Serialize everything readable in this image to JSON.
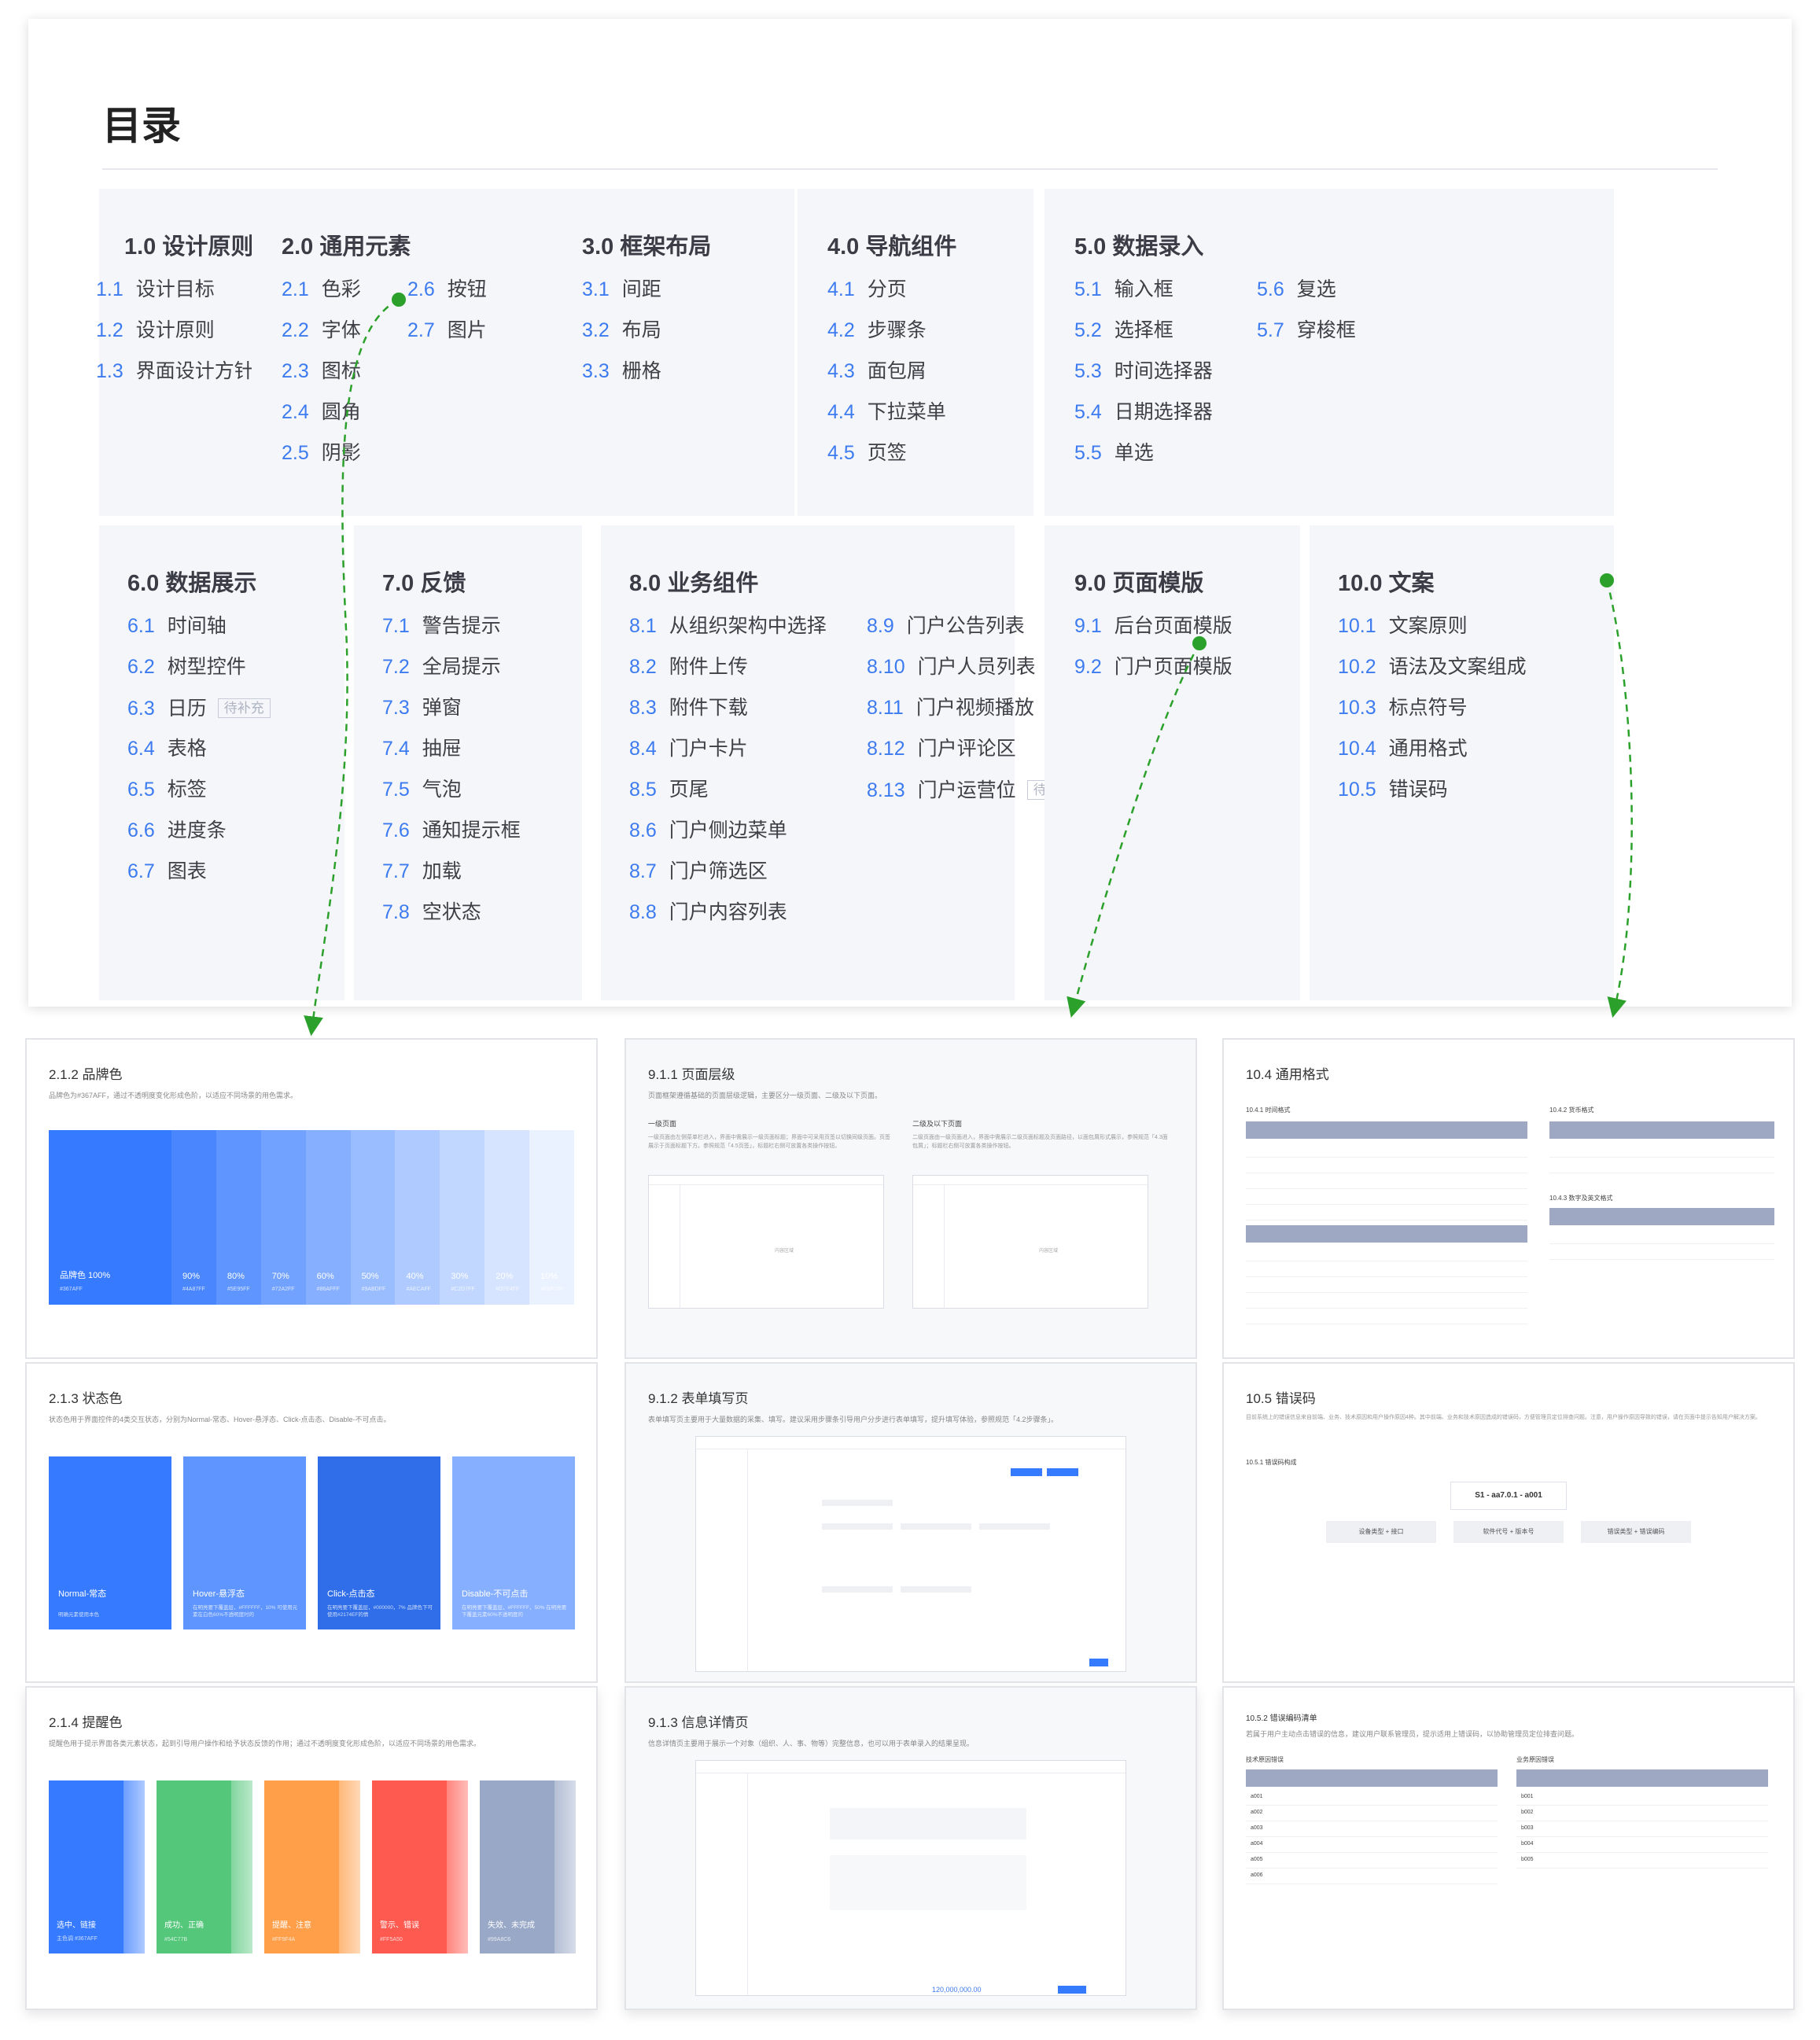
{
  "toc": {
    "title": "目录",
    "sections": [
      {
        "head": "1.0 设计原则",
        "items": [
          {
            "n": "1.1",
            "t": "设计目标"
          },
          {
            "n": "1.2",
            "t": "设计原则"
          },
          {
            "n": "1.3",
            "t": "界面设计方针"
          }
        ]
      },
      {
        "head": "2.0 通用元素",
        "items": [
          {
            "n": "2.1",
            "t": "色彩"
          },
          {
            "n": "2.2",
            "t": "字体"
          },
          {
            "n": "2.3",
            "t": "图标"
          },
          {
            "n": "2.4",
            "t": "圆角"
          },
          {
            "n": "2.5",
            "t": "阴影"
          },
          {
            "n": "2.6",
            "t": "按钮"
          },
          {
            "n": "2.7",
            "t": "图片"
          }
        ]
      },
      {
        "head": "3.0 框架布局",
        "items": [
          {
            "n": "3.1",
            "t": "间距"
          },
          {
            "n": "3.2",
            "t": "布局"
          },
          {
            "n": "3.3",
            "t": "栅格"
          }
        ]
      },
      {
        "head": "4.0 导航组件",
        "items": [
          {
            "n": "4.1",
            "t": "分页"
          },
          {
            "n": "4.2",
            "t": "步骤条"
          },
          {
            "n": "4.3",
            "t": "面包屑"
          },
          {
            "n": "4.4",
            "t": "下拉菜单"
          },
          {
            "n": "4.5",
            "t": "页签"
          }
        ]
      },
      {
        "head": "5.0 数据录入",
        "items": [
          {
            "n": "5.1",
            "t": "输入框"
          },
          {
            "n": "5.2",
            "t": "选择框"
          },
          {
            "n": "5.3",
            "t": "时间选择器"
          },
          {
            "n": "5.4",
            "t": "日期选择器"
          },
          {
            "n": "5.5",
            "t": "单选"
          },
          {
            "n": "5.6",
            "t": "复选"
          },
          {
            "n": "5.7",
            "t": "穿梭框"
          }
        ]
      },
      {
        "head": "6.0 数据展示",
        "items": [
          {
            "n": "6.1",
            "t": "时间轴"
          },
          {
            "n": "6.2",
            "t": "树型控件"
          },
          {
            "n": "6.3",
            "t": "日历",
            "tag": "待补充"
          },
          {
            "n": "6.4",
            "t": "表格"
          },
          {
            "n": "6.5",
            "t": "标签"
          },
          {
            "n": "6.6",
            "t": "进度条"
          },
          {
            "n": "6.7",
            "t": "图表"
          }
        ]
      },
      {
        "head": "7.0 反馈",
        "items": [
          {
            "n": "7.1",
            "t": "警告提示"
          },
          {
            "n": "7.2",
            "t": "全局提示"
          },
          {
            "n": "7.3",
            "t": "弹窗"
          },
          {
            "n": "7.4",
            "t": "抽屉"
          },
          {
            "n": "7.5",
            "t": "气泡"
          },
          {
            "n": "7.6",
            "t": "通知提示框"
          },
          {
            "n": "7.7",
            "t": "加载"
          },
          {
            "n": "7.8",
            "t": "空状态"
          }
        ]
      },
      {
        "head": "8.0 业务组件",
        "items": [
          {
            "n": "8.1",
            "t": "从组织架构中选择"
          },
          {
            "n": "8.2",
            "t": "附件上传"
          },
          {
            "n": "8.3",
            "t": "附件下载"
          },
          {
            "n": "8.4",
            "t": "门户卡片"
          },
          {
            "n": "8.5",
            "t": "页尾"
          },
          {
            "n": "8.6",
            "t": "门户侧边菜单"
          },
          {
            "n": "8.7",
            "t": "门户筛选区"
          },
          {
            "n": "8.8",
            "t": "门户内容列表"
          },
          {
            "n": "8.9",
            "t": "门户公告列表"
          },
          {
            "n": "8.10",
            "t": "门户人员列表"
          },
          {
            "n": "8.11",
            "t": "门户视频播放"
          },
          {
            "n": "8.12",
            "t": "门户评论区"
          },
          {
            "n": "8.13",
            "t": "门户运营位",
            "tag": "待补充"
          }
        ]
      },
      {
        "head": "9.0 页面模版",
        "items": [
          {
            "n": "9.1",
            "t": "后台页面模版"
          },
          {
            "n": "9.2",
            "t": "门户页面模版"
          }
        ]
      },
      {
        "head": "10.0 文案",
        "items": [
          {
            "n": "10.1",
            "t": "文案原则"
          },
          {
            "n": "10.2",
            "t": "语法及文案组成"
          },
          {
            "n": "10.3",
            "t": "标点符号"
          },
          {
            "n": "10.4",
            "t": "通用格式"
          },
          {
            "n": "10.5",
            "t": "错误码"
          }
        ]
      }
    ]
  },
  "colors": {
    "accent": "#3d7bf0",
    "arrow": "#2ba12b",
    "block_bg": "#f5f6f9"
  },
  "cards": {
    "brand": {
      "title": "2.1.2 品牌色",
      "desc": "品牌色为#367AFF，通过不透明度变化形成色阶，以适应不同场景的用色需求。",
      "main_label": "品牌色 100%",
      "main_hex": "#367AFF",
      "steps": [
        "90%",
        "80%",
        "70%",
        "60%",
        "50%",
        "40%",
        "30%",
        "20%",
        "10%"
      ],
      "step_hex": [
        "#4A87FF",
        "#5E95FF",
        "#72A2FF",
        "#86AFFF",
        "#9ABDFF",
        "#AECAFF",
        "#C2D7FF",
        "#D7E4FF",
        "#EBF2FF"
      ]
    },
    "state": {
      "title": "2.1.3 状态色",
      "desc": "状态色用于界面控件的4类交互状态，分别为Normal-常态、Hover-悬浮态、Click-点击态、Disable-不可点击。",
      "boxes": [
        {
          "name": "Normal-常态",
          "note": "明确元素使用本色",
          "color": "#367AFF"
        },
        {
          "name": "Hover-悬浮态",
          "note": "在明亮要下覆盖层，#FFFFFF，10% 可使用元素在白色60%不透明度时的",
          "color": "#5E95FF"
        },
        {
          "name": "Click-点击态",
          "note": "在明亮要下覆盖层，#000000，7% 品牌色下可使用#2174EF的情",
          "color": "#2F6EE8"
        },
        {
          "name": "Disable-不可点击",
          "note": "在明亮要下覆盖层，#FFFFFF，50% 在明亮要下覆盖元素60%不透明度的",
          "color": "#86AFFF"
        }
      ]
    },
    "alert": {
      "title": "2.1.4 提醒色",
      "desc": "提醒色用于提示界面各类元素状态，起到引导用户操作和给予状态反馈的作用；通过不透明度变化形成色阶，以适应不同场景的用色需求。",
      "boxes": [
        {
          "name": "选中、链接",
          "hex": "主色调 #367AFF",
          "color": "#367AFF"
        },
        {
          "name": "成功、正确",
          "hex": "#54C77B",
          "color": "#54C77B"
        },
        {
          "name": "提醒、注意",
          "hex": "#FF9F4A",
          "color": "#FF9F4A"
        },
        {
          "name": "警示、错误",
          "hex": "#FF5A50",
          "color": "#FF5A50"
        },
        {
          "name": "失效、未完成",
          "hex": "#99A8C6",
          "color": "#99A8C6"
        }
      ]
    },
    "layer": {
      "title": "9.1.1 页面层级",
      "desc": "页面框架遵循基础的页面层级逻辑，主要区分一级页面、二级及以下页面。",
      "left_t": "一级页面",
      "right_t": "二级及以下页面",
      "left_d": "一级页面由左侧菜单栏进入，界面中需展示一级页面标题；界面中可采用页签以切换同级页面。页签展示于页面标题下方。参照规范「4.5页签」，标题栏右侧可放置各类操作按钮。",
      "right_d": "二级页面由一级页面进入，界面中需展示二级页面标题及页面路径，以面包屑形式展示，参照规范「4.3面包屑」；标题栏右侧可放置各类操作按钮。",
      "content": "内容区域"
    },
    "form": {
      "title": "9.1.2 表单填写页",
      "desc": "表单填写页主要用于大量数据的采集、填写。建议采用步骤条引导用户分步进行表单填写，提升填写体验，参照规范「4.2步骤条」。"
    },
    "detail": {
      "title": "9.1.3 信息详情页",
      "desc": "信息详情页主要用于展示一个对象（组织、人、事、物等）完整信息，也可以用于表单录入的结果呈现。",
      "amount": "120,000,000.00"
    },
    "format": {
      "title": "10.4 通用格式",
      "t1": "10.4.1 时间格式",
      "t2": "10.4.2 货币格式",
      "t3": "10.4.3 数字及英文格式"
    },
    "errcode": {
      "title": "10.5 错误码",
      "sub": "10.5.1 错误码构成",
      "code": "S1 - aa7.0.1 - a001",
      "desc": "目前系统上的错误信息来自前端、业务、技术原因和用户操作原因4种。其中前端、业务和技术原因造成的错误码，方便管理员定位排查问题。注意，用户操作原因导致的错误，请在页面中提示告知用户解决方案。",
      "parts": [
        "设备类型 + 接口",
        "软件代号 + 版本号",
        "错误类型 + 错误编码"
      ]
    },
    "errlist": {
      "title": "10.5.2 错误编码清单",
      "desc": "若属于用户主动点击错误的信息，建议用户联系管理员，提示适用上错误码，以协助管理员定位排查问题。",
      "left_t": "技术原因错误",
      "right_t": "业务原因错误",
      "left_codes": [
        "a001",
        "a002",
        "a003",
        "a004",
        "a005",
        "a006"
      ],
      "right_codes": [
        "b001",
        "b002",
        "b003",
        "b004",
        "b005"
      ]
    }
  }
}
